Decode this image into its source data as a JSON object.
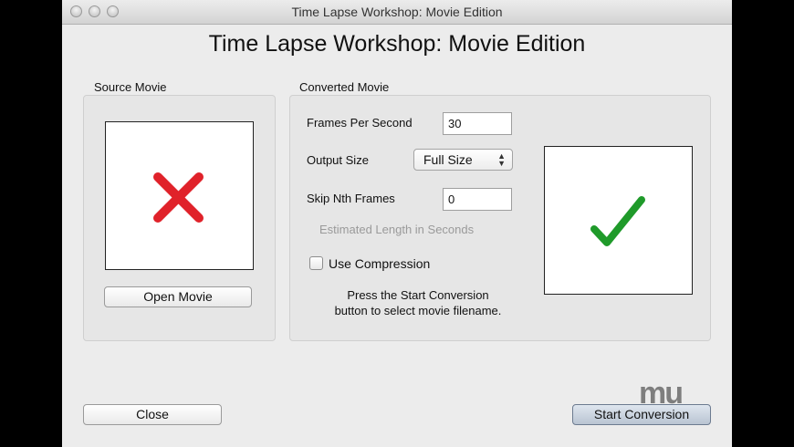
{
  "window": {
    "title": "Time Lapse Workshop: Movie Edition"
  },
  "header": {
    "title": "Time Lapse Workshop: Movie Edition"
  },
  "source": {
    "group_label": "Source Movie",
    "preview_icon": "red-x-icon",
    "open_button_label": "Open Movie"
  },
  "converted": {
    "group_label": "Converted Movie",
    "fps_label": "Frames Per Second",
    "fps_value": "30",
    "output_size_label": "Output Size",
    "output_size_value": "Full Size",
    "skip_label": "Skip Nth Frames",
    "skip_value": "0",
    "estimated_label": "Estimated Length in Seconds",
    "compression_label": "Use Compression",
    "compression_checked": false,
    "hint_line1": "Press the Start Conversion",
    "hint_line2": "button to select movie filename.",
    "preview_icon": "green-check-icon"
  },
  "footer": {
    "close_label": "Close",
    "start_label": "Start Conversion"
  },
  "watermark": {
    "text": "mu",
    "icon": "macupdate-logo-icon"
  },
  "colors": {
    "x_red": "#e0222a",
    "check_green": "#1f9a2a",
    "window_bg": "#ececec"
  }
}
